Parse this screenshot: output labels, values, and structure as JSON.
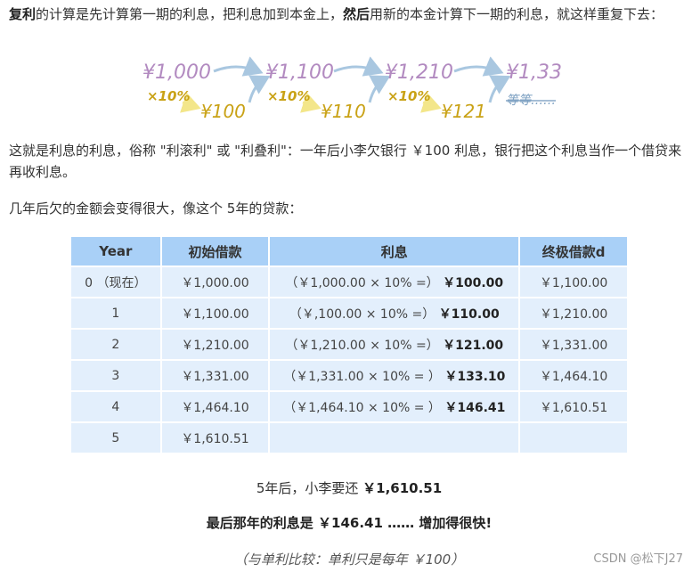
{
  "intro": {
    "bold1": "复利",
    "text1": "的计算是先计算第一期的利息，把利息加到本金上，",
    "bold2": "然后",
    "text2": "用新的本金计算下一期的利息，就这样重复下去："
  },
  "diagram": {
    "amounts": [
      "¥1,000",
      "¥1,100",
      "¥1,210",
      "¥1,33"
    ],
    "rates": [
      "×10%",
      "×10%",
      "×10%"
    ],
    "interests": [
      "¥100",
      "¥110",
      "¥121"
    ],
    "etc": "等等……",
    "colors": {
      "amount": "#b28ac0",
      "interest": "#c9a216",
      "arrow": "#a9c7e0",
      "rate_arrow": "#f3e68a"
    }
  },
  "para2": "这就是利息的利息，俗称 \"利滚利\" 或 \"利叠利\"：一年后小李欠银行 ￥100 利息，银行把这个利息当作一个借贷来再收利息。",
  "para3": "几年后欠的金额会变得很大，像这个 5年的贷款：",
  "table": {
    "headers": [
      "Year",
      "初始借款",
      "利息",
      "终极借款d"
    ],
    "rows": [
      {
        "year": "0 （现在）",
        "start": "￥1,000.00",
        "calc": "（￥1,000.00 × 10% =）",
        "interest": "￥100.00",
        "end": "￥1,100.00"
      },
      {
        "year": "1",
        "start": "￥1,100.00",
        "calc": "（￥,100.00 × 10% =）",
        "interest": "￥110.00",
        "end": "￥1,210.00"
      },
      {
        "year": "2",
        "start": "￥1,210.00",
        "calc": "（￥1,210.00 × 10% =）",
        "interest": "￥121.00",
        "end": "￥1,331.00"
      },
      {
        "year": "3",
        "start": "￥1,331.00",
        "calc": "（￥1,331.00 × 10% = ）",
        "interest": "￥133.10",
        "end": "￥1,464.10"
      },
      {
        "year": "4",
        "start": "￥1,464.10",
        "calc": "（￥1,464.10 × 10% = ）",
        "interest": "￥146.41",
        "end": "￥1,610.51"
      },
      {
        "year": "5",
        "start": "￥1,610.51",
        "calc": "",
        "interest": "",
        "end": ""
      }
    ]
  },
  "summary": {
    "line1_text": "5年后，小李要还 ",
    "line1_amount": "￥1,610.51",
    "line2": "最后那年的利息是 ￥146.41 …… 增加得很快!",
    "line3": "（与单利比较：单利只是每年 ￥100）"
  },
  "watermark": "CSDN @松下J27"
}
